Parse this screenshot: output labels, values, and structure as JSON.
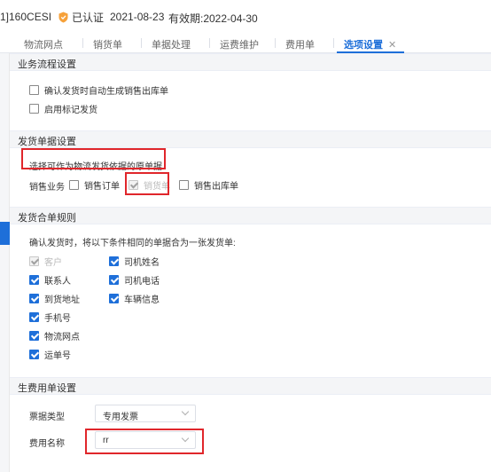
{
  "header": {
    "company": "1]160CESI",
    "cert_label": "已认证",
    "date": "2021-08-23",
    "expiry": "有效期:2022-04-30"
  },
  "tabs": [
    {
      "label": "物流网点"
    },
    {
      "label": "销货单"
    },
    {
      "label": "单据处理"
    },
    {
      "label": "运费维护"
    },
    {
      "label": "费用单"
    },
    {
      "label": "选项设置",
      "close": "✕"
    }
  ],
  "business_flow": {
    "title": "业务流程设置",
    "options": [
      {
        "label": "确认发货时自动生成销售出库单",
        "checked": false
      },
      {
        "label": "启用标记发货",
        "checked": false
      }
    ]
  },
  "shipping_docs": {
    "title": "发货单据设置",
    "hint": "选择可作为物流发货依据的原单据",
    "group_label": "销售业务",
    "options": [
      {
        "label": "销售订单",
        "checked": false,
        "disabled": false
      },
      {
        "label": "销货单",
        "checked": true,
        "disabled": true
      },
      {
        "label": "销售出库单",
        "checked": false,
        "disabled": false
      }
    ]
  },
  "merge_rules": {
    "title": "发货合单规则",
    "intro": "确认发货时，将以下条件相同的单据合为一张发货单:",
    "left_options": [
      {
        "label": "客户",
        "checked": true,
        "disabled": true
      },
      {
        "label": "联系人",
        "checked": true,
        "disabled": false
      },
      {
        "label": "到货地址",
        "checked": true,
        "disabled": false
      },
      {
        "label": "手机号",
        "checked": true,
        "disabled": false
      },
      {
        "label": "物流网点",
        "checked": true,
        "disabled": false
      },
      {
        "label": "运单号",
        "checked": true,
        "disabled": false
      }
    ],
    "right_options": [
      {
        "label": "司机姓名",
        "checked": true,
        "disabled": false
      },
      {
        "label": "司机电话",
        "checked": true,
        "disabled": false
      },
      {
        "label": "车辆信息",
        "checked": true,
        "disabled": false
      }
    ]
  },
  "expense_doc": {
    "title": "生费用单设置",
    "invoice_type_label": "票据类型",
    "invoice_type_value": "专用发票",
    "expense_name_label": "费用名称",
    "expense_name_value": "rr"
  },
  "colors": {
    "accent": "#1e6fd9",
    "highlight_box": "#e0262b",
    "section_bg": "#f4f5f7"
  }
}
